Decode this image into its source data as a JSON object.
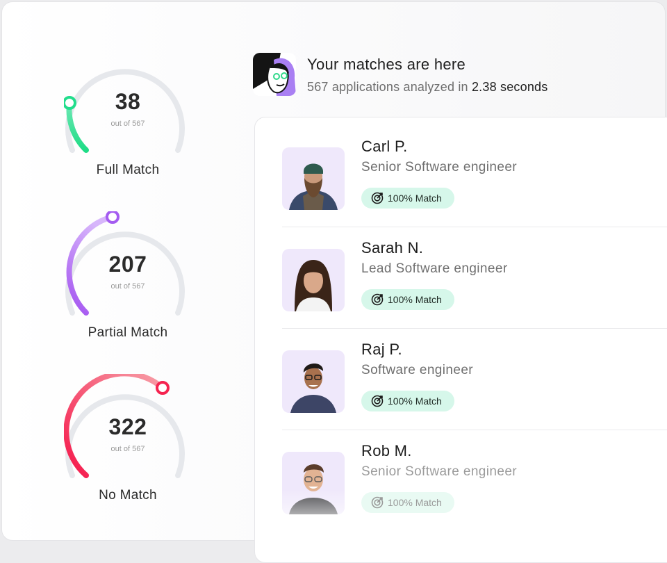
{
  "header": {
    "title": "Your matches are here",
    "subtitle_prefix": "567 applications analyzed in",
    "subtitle_time": "2.38 seconds"
  },
  "gauges": [
    {
      "value": "38",
      "out_of": "out of 567",
      "label": "Full Match",
      "fraction": 0.067,
      "color": "#22dd8c"
    },
    {
      "value": "207",
      "out_of": "out of 567",
      "label": "Partial Match",
      "fraction": 0.365,
      "color": "#a45cf0"
    },
    {
      "value": "322",
      "out_of": "out of 567",
      "label": "No Match",
      "fraction": 0.568,
      "color": "#f5234f"
    }
  ],
  "candidates": [
    {
      "name": "Carl P.",
      "role": "Senior Software engineer",
      "badge": "100% Match"
    },
    {
      "name": "Sarah N.",
      "role": "Lead Software engineer",
      "badge": "100% Match"
    },
    {
      "name": "Raj P.",
      "role": "Software engineer",
      "badge": "100% Match"
    },
    {
      "name": "Rob M.",
      "role": "Senior Software engineer",
      "badge": "100% Match"
    }
  ],
  "colors": {
    "badge_bg": "#d6f7ea",
    "track": "#e6e8ec"
  },
  "icons": {
    "badge": "target-icon"
  }
}
